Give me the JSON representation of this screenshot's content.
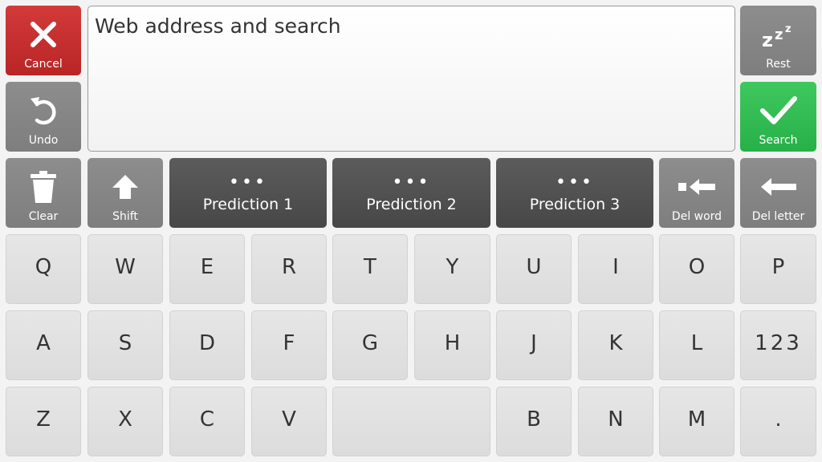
{
  "text_field": {
    "value": "Web address and search"
  },
  "side_buttons": {
    "cancel": "Cancel",
    "undo": "Undo",
    "rest": "Rest",
    "search": "Search",
    "clear": "Clear",
    "shift": "Shift",
    "del_word": "Del word",
    "del_letter": "Del letter"
  },
  "predictions": [
    {
      "dots": "•••",
      "label": "Prediction 1"
    },
    {
      "dots": "•••",
      "label": "Prediction 2"
    },
    {
      "dots": "•••",
      "label": "Prediction 3"
    }
  ],
  "keyboard": {
    "row1": [
      "Q",
      "W",
      "E",
      "R",
      "T",
      "Y",
      "U",
      "I",
      "O",
      "P"
    ],
    "row2": [
      "A",
      "S",
      "D",
      "F",
      "G",
      "H",
      "J",
      "K",
      "L",
      "123"
    ],
    "row3": [
      "Z",
      "X",
      "C",
      "V",
      "",
      "B",
      "N",
      "M",
      "."
    ]
  },
  "icons": {
    "cancel": "close-icon",
    "undo": "undo-icon",
    "rest": "sleep-icon",
    "search": "checkmark-icon",
    "clear": "trash-icon",
    "shift": "shift-arrow-icon",
    "del_word": "delete-word-icon",
    "del_letter": "backspace-arrow-icon"
  },
  "colors": {
    "cancel": "#c82f2f",
    "search": "#2fbb50",
    "function": "#888888",
    "prediction": "#515151",
    "key": "#e1e1e1"
  }
}
